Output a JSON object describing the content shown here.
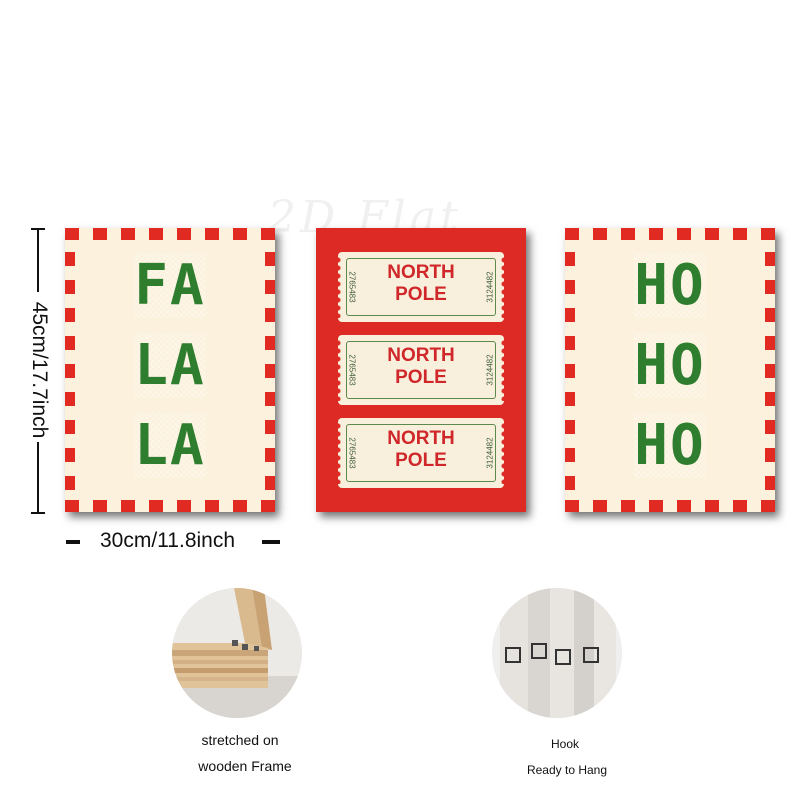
{
  "watermark": "2D Flat",
  "dimensions": {
    "height_label": "45cm/17.7inch",
    "width_label": "30cm/11.8inch"
  },
  "panels": {
    "left": {
      "lines": [
        "FA",
        "LA",
        "LA"
      ],
      "stitch_color": "#2f7d2f"
    },
    "middle": {
      "background_color": "#dd2a24",
      "tickets": [
        {
          "line1": "NORTH",
          "line2": "POLE",
          "serial_left": "2765483",
          "serial_right": "3124482"
        },
        {
          "line1": "NORTH",
          "line2": "POLE",
          "serial_left": "2765483",
          "serial_right": "3124482"
        },
        {
          "line1": "NORTH",
          "line2": "POLE",
          "serial_left": "2765483",
          "serial_right": "3124482"
        }
      ]
    },
    "right": {
      "lines": [
        "HO",
        "HO",
        "HO"
      ],
      "stitch_color": "#2f7d2f"
    },
    "stripe_color": "#e02a22",
    "cream_color": "#fbf1dc"
  },
  "features": {
    "frame": {
      "caption_line1": "stretched on",
      "caption_line2": "wooden Frame"
    },
    "hook": {
      "caption_line1": "Hook",
      "caption_line2": "Ready to Hang"
    }
  }
}
